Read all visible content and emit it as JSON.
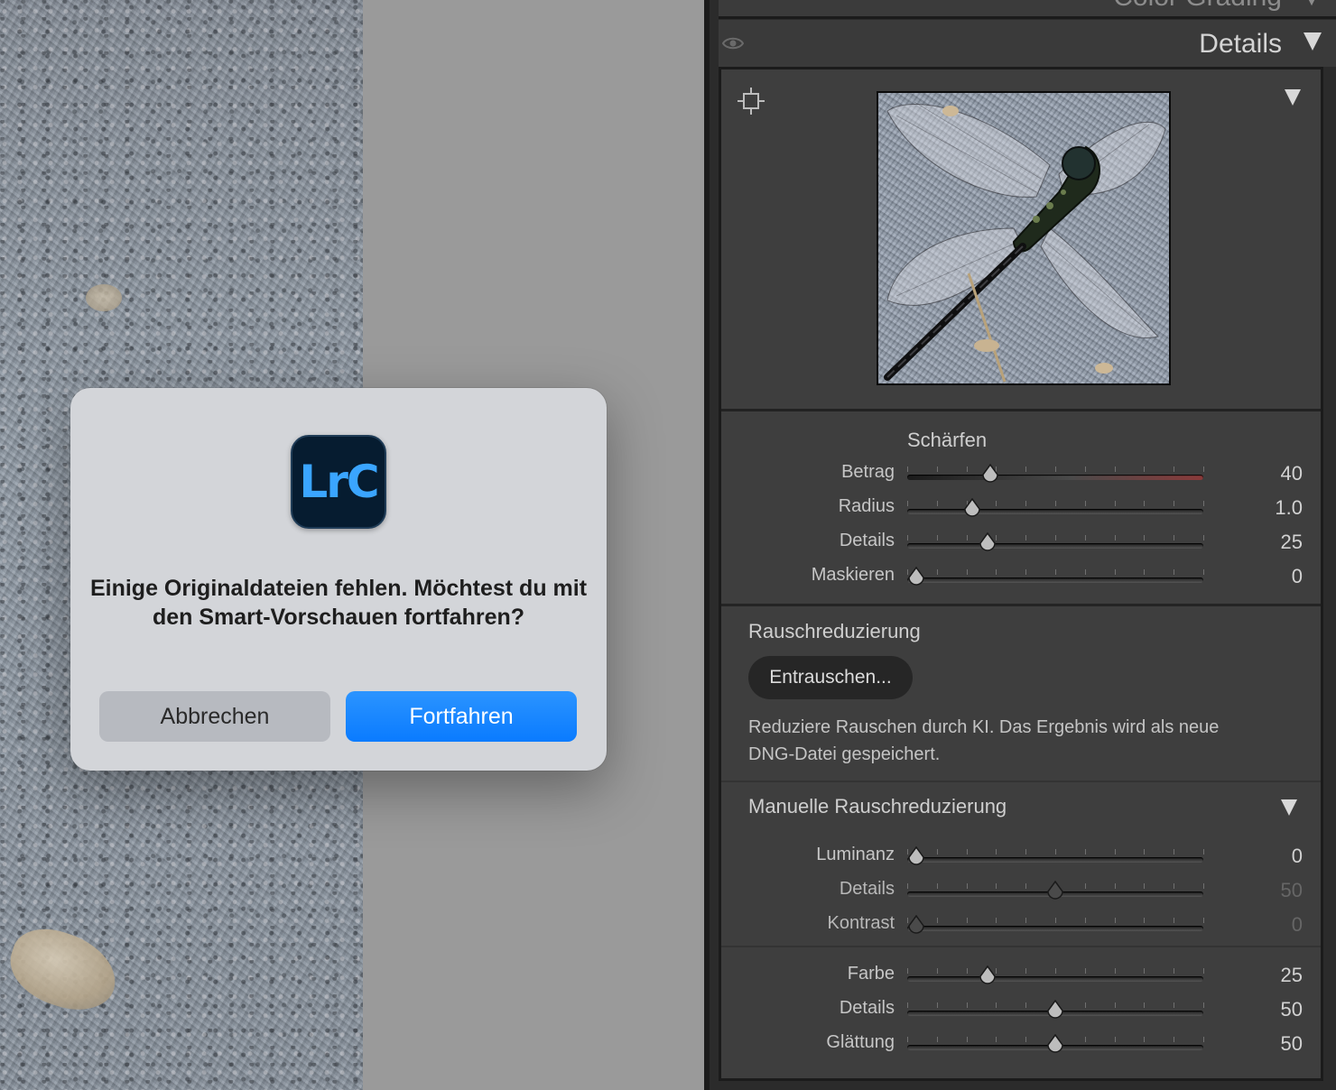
{
  "dialog": {
    "app_icon_label": "LrC",
    "message": "Einige Originaldateien fehlen. Möchtest du mit den Smart-Vorschauen fortfahren?",
    "cancel_label": "Abbrechen",
    "confirm_label": "Fortfahren"
  },
  "panel": {
    "previous_section_title": "Color Grading",
    "title": "Details",
    "sharpening": {
      "label": "Schärfen",
      "sliders": [
        {
          "label": "Betrag",
          "value": "40",
          "fraction": 0.28
        },
        {
          "label": "Radius",
          "value": "1.0",
          "fraction": 0.22
        },
        {
          "label": "Details",
          "value": "25",
          "fraction": 0.27
        },
        {
          "label": "Maskieren",
          "value": "0",
          "fraction": 0.03
        }
      ]
    },
    "noise_reduction": {
      "label": "Rauschreduzierung",
      "denoise_button": "Entrauschen...",
      "description": "Reduziere Rauschen durch KI. Das Ergebnis wird als neue DNG-Datei gespeichert."
    },
    "manual_noise_reduction": {
      "label": "Manuelle Rauschreduzierung",
      "luminance_sliders": [
        {
          "label": "Luminanz",
          "value": "0",
          "fraction": 0.03
        },
        {
          "label": "Details",
          "value": "50",
          "fraction": 0.5
        },
        {
          "label": "Kontrast",
          "value": "0",
          "fraction": 0.03
        }
      ],
      "color_sliders": [
        {
          "label": "Farbe",
          "value": "25",
          "fraction": 0.27
        },
        {
          "label": "Details",
          "value": "50",
          "fraction": 0.5
        },
        {
          "label": "Glättung",
          "value": "50",
          "fraction": 0.5
        }
      ]
    }
  },
  "icons": {
    "visibility": "eye-icon",
    "target": "target-adjustment-icon",
    "collapse": "triangle-down-icon"
  },
  "colors": {
    "accent": "#0a7bff",
    "panel_background": "#3e3e3e"
  }
}
